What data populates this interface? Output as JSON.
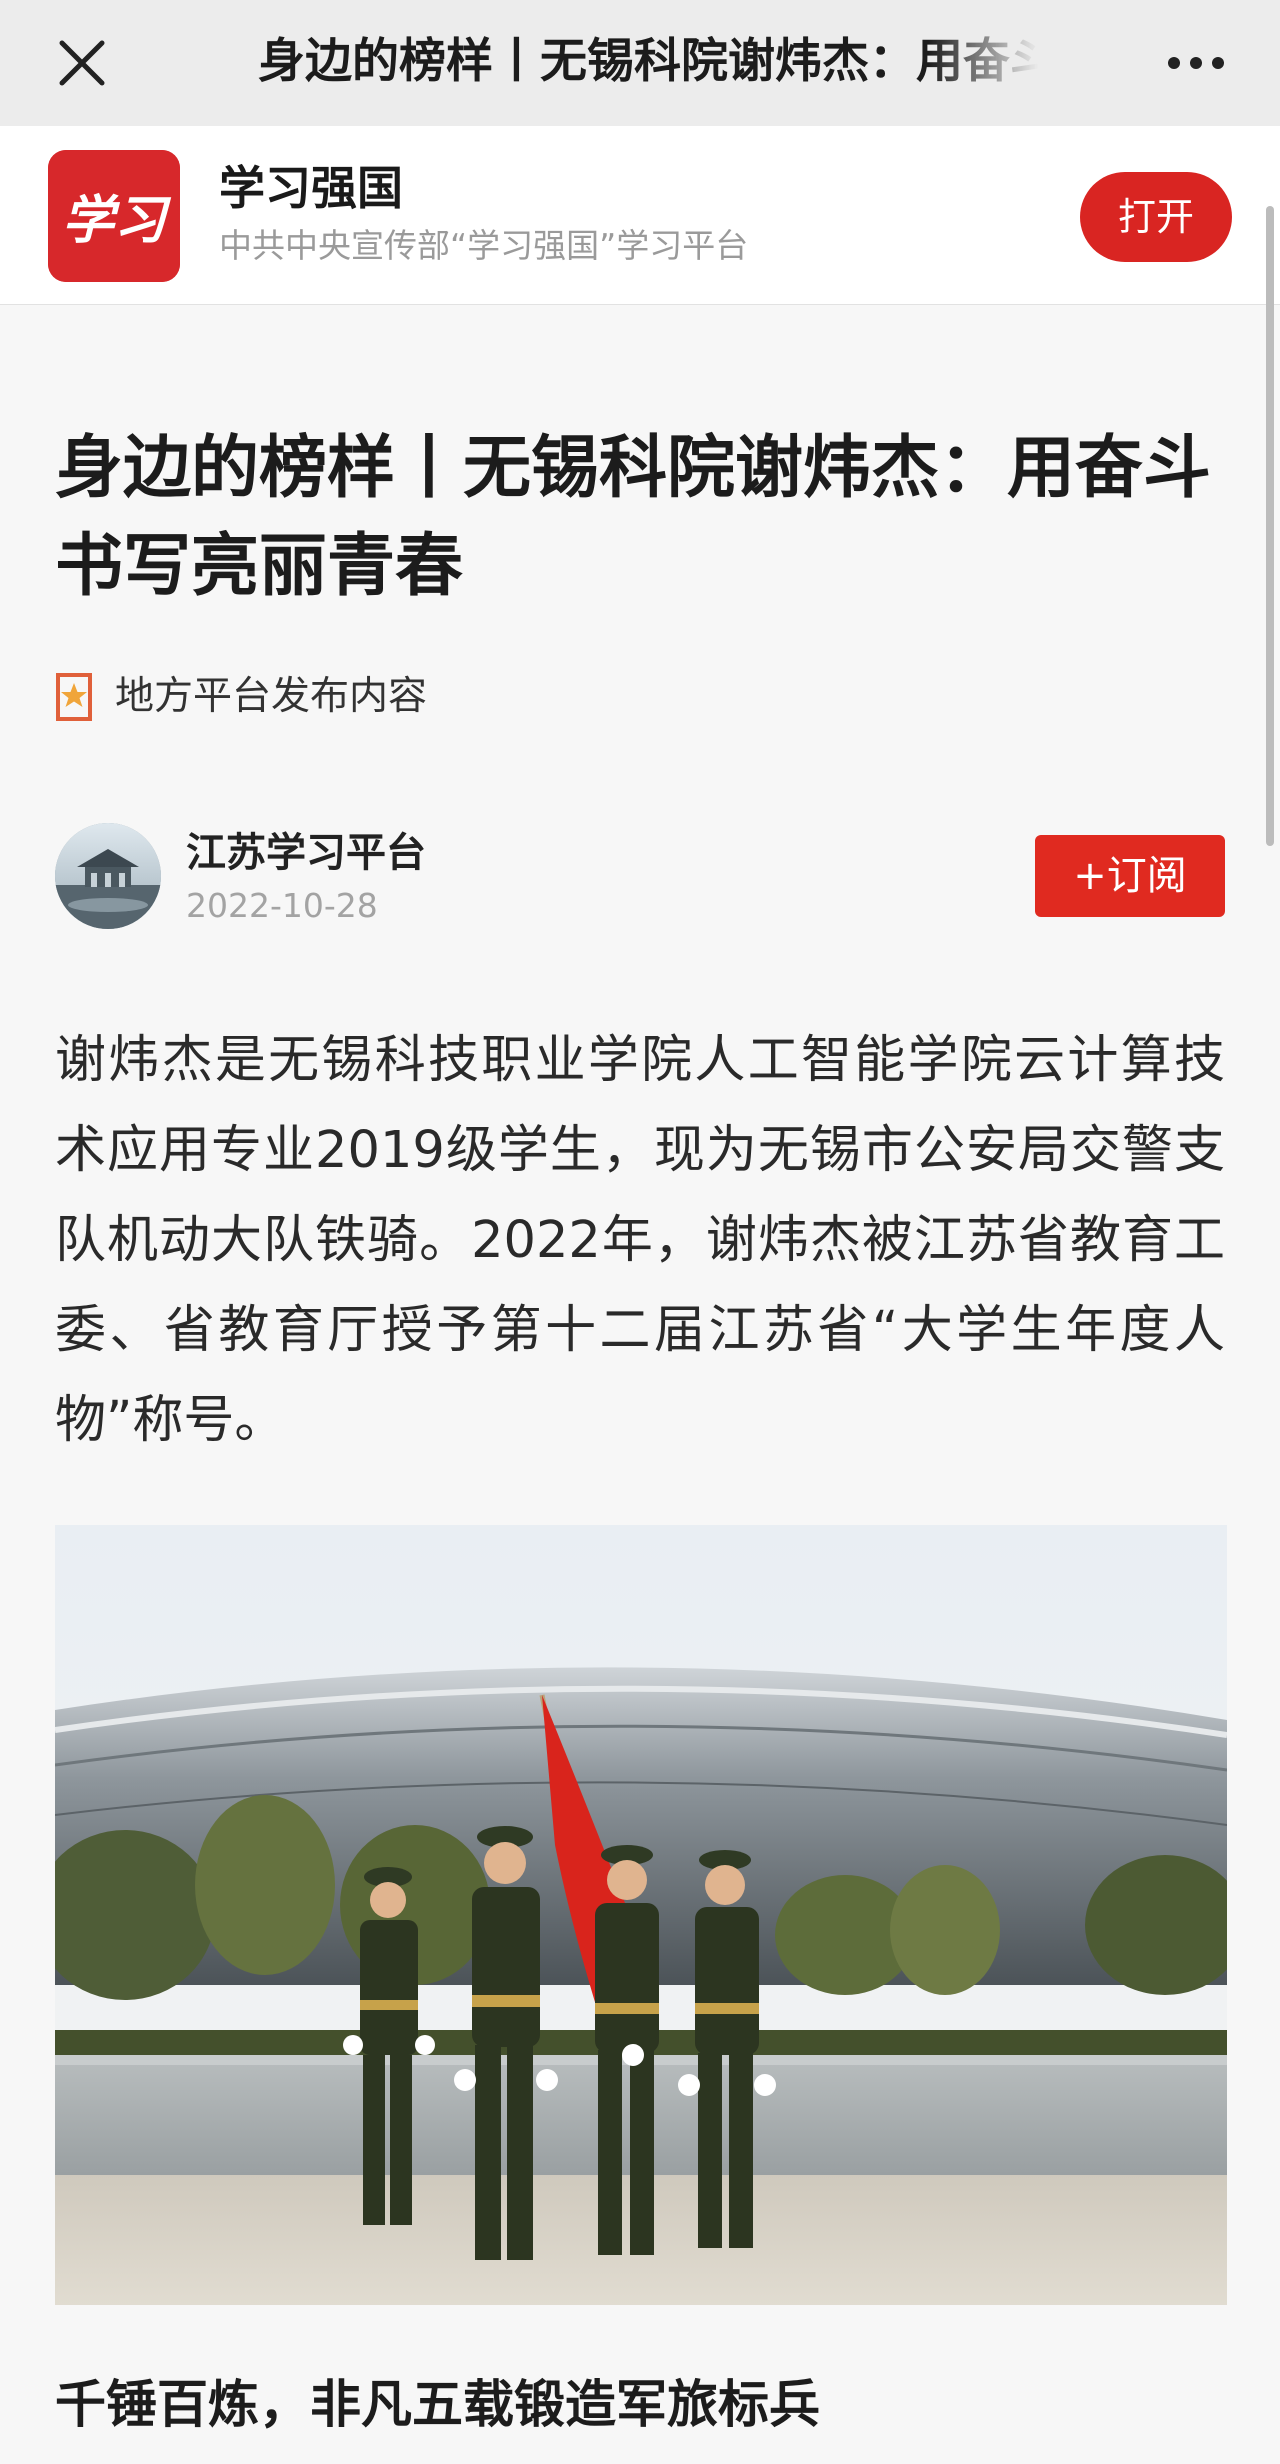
{
  "nav": {
    "title": "身边的榜样丨无锡科院谢炜杰：用奋斗书写亮丽青春",
    "close_icon": "close-icon",
    "more_icon": "more-icon"
  },
  "app_banner": {
    "logo_text": "学习",
    "name": "学习强国",
    "description": "中共中央宣传部“学习强国”学习平台",
    "open_label": "打开",
    "accent_color": "#d92522"
  },
  "article": {
    "title": "身边的榜样丨无锡科院谢炜杰：用奋斗书写亮丽青春",
    "source_tag": "地方平台发布内容",
    "author": {
      "name": "江苏学习平台",
      "date": "2022-10-28",
      "subscribe_label": "+订阅"
    },
    "paragraph": "谢炜杰是无锡科技职业学院人工智能学院云计算技术应用专业2019级学生，现为无锡市公安局交警支队机动大队铁骑。2022年，谢炜杰被江苏省教育工委、省教育厅授予第十二届江苏省“大学生年度人物”称号。",
    "section_heading": "千锤百炼，非凡五载锻造军旅标兵"
  }
}
